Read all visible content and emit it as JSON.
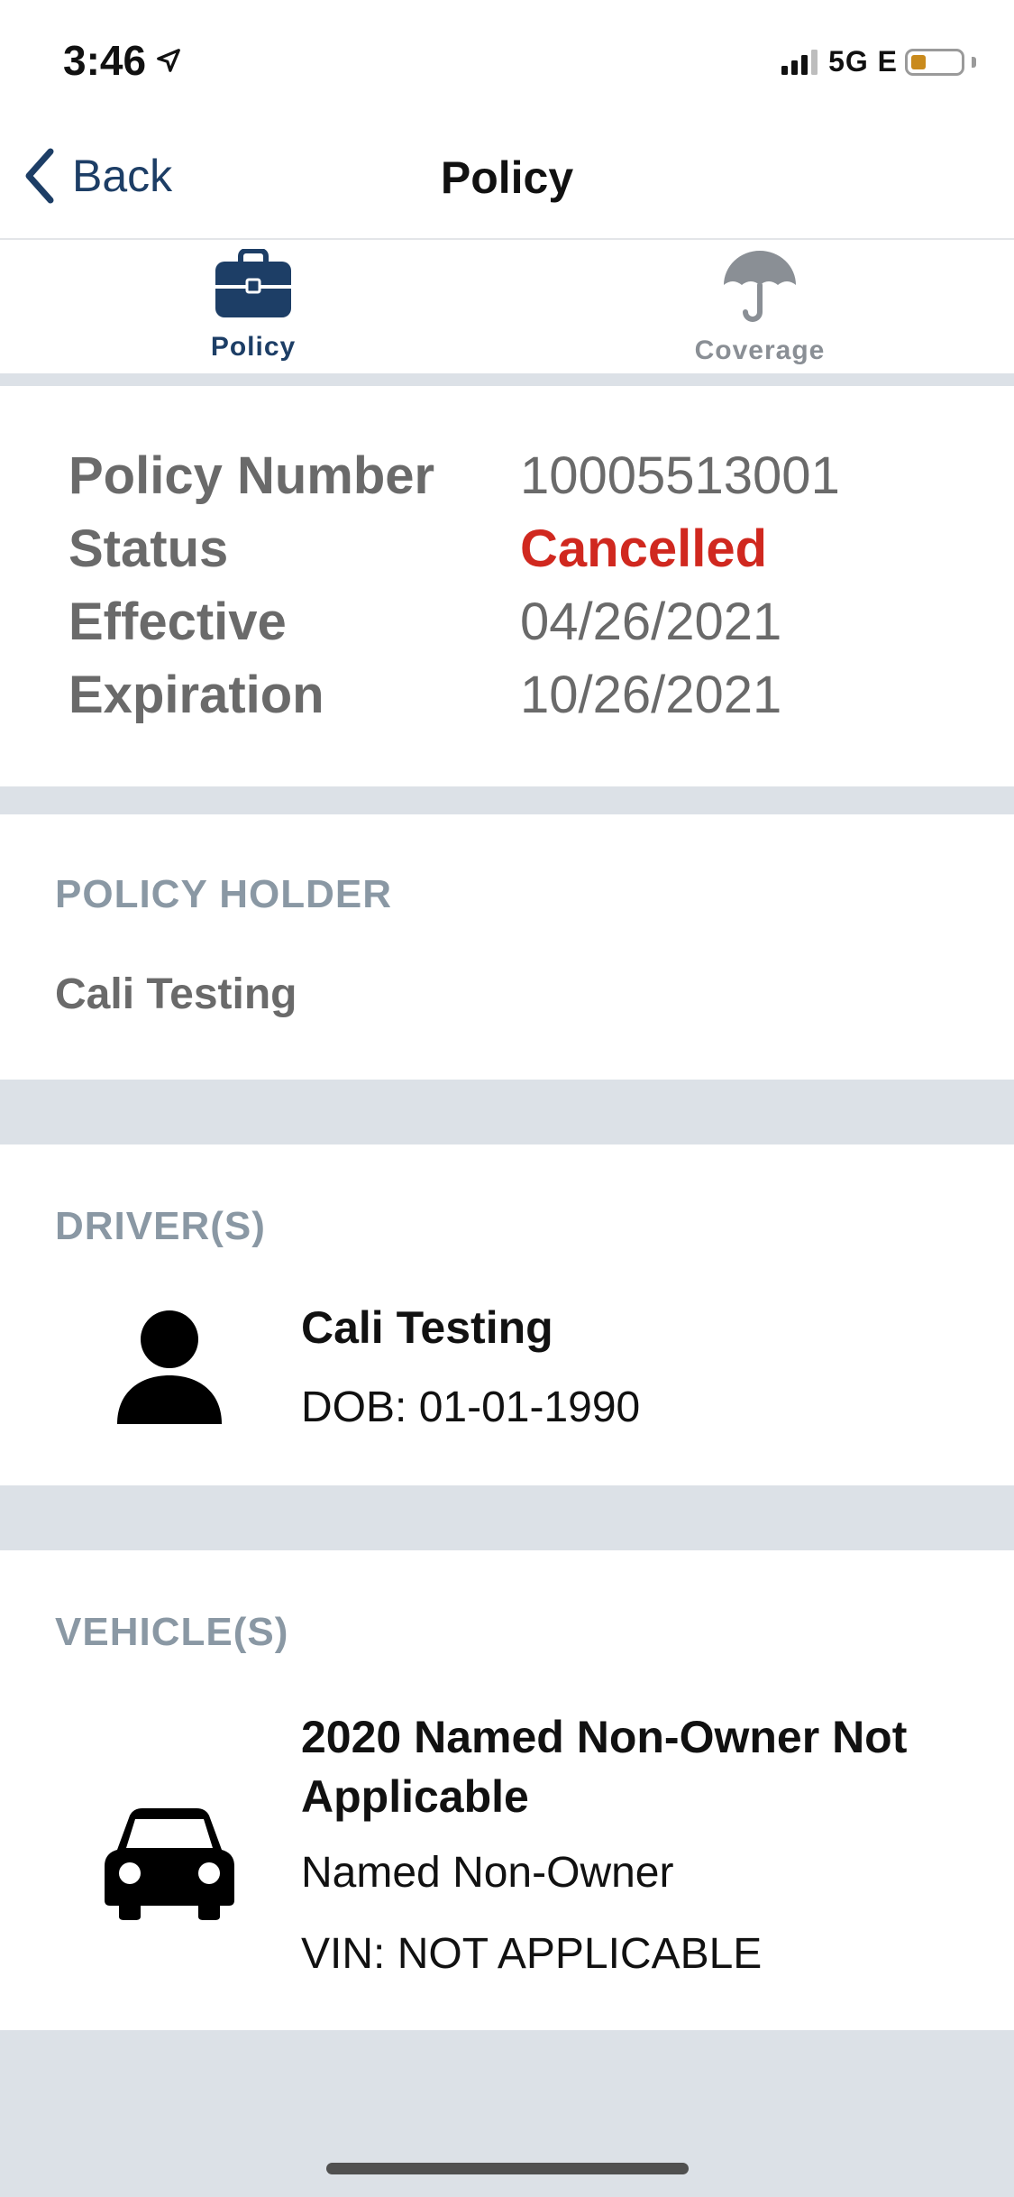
{
  "status_bar": {
    "time": "3:46",
    "network": "5G E",
    "location_icon": "location-arrow-icon",
    "signal_icon": "signal-bars-icon",
    "battery_icon": "battery-low-icon"
  },
  "nav": {
    "back_label": "Back",
    "title": "Policy",
    "back_icon": "chevron-left-icon"
  },
  "tabs": [
    {
      "label": "Policy",
      "icon": "briefcase-icon",
      "active": true
    },
    {
      "label": "Coverage",
      "icon": "umbrella-icon",
      "active": false
    }
  ],
  "summary": {
    "policy_number_label": "Policy Number",
    "policy_number": "10005513001",
    "status_label": "Status",
    "status": "Cancelled",
    "effective_label": "Effective",
    "effective": "04/26/2021",
    "expiration_label": "Expiration",
    "expiration": "10/26/2021"
  },
  "policy_holder": {
    "section_title": "POLICY HOLDER",
    "name": "Cali Testing"
  },
  "drivers": {
    "section_title": "DRIVER(S)",
    "items": [
      {
        "name": "Cali Testing",
        "dob": "DOB: 01-01-1990",
        "icon": "person-icon"
      }
    ]
  },
  "vehicles": {
    "section_title": "VEHICLE(S)",
    "items": [
      {
        "title_line1": "2020 Named Non-Owner Not",
        "title_line2": "Applicable",
        "type": "Named Non-Owner",
        "vin": "VIN: NOT APPLICABLE",
        "icon": "car-icon"
      }
    ]
  },
  "colors": {
    "brand_navy": "#1d3e66",
    "status_cancelled": "#d0281f",
    "section_title": "#8a98a4",
    "background": "#dce1e7"
  }
}
